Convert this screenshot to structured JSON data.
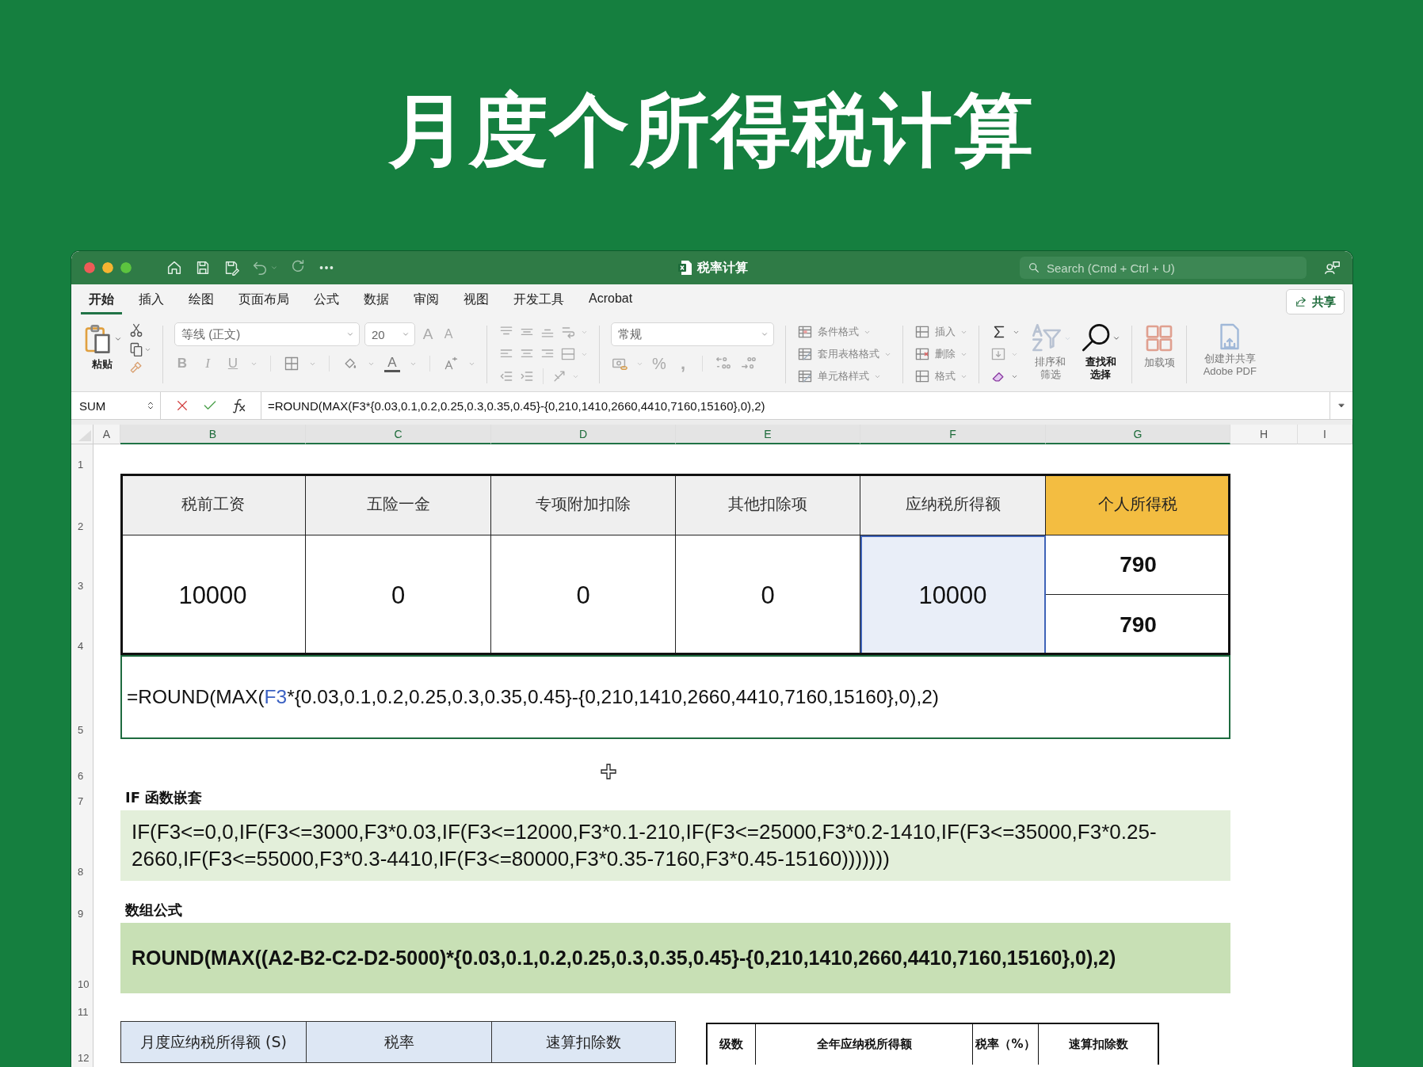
{
  "headline": "月度个所得税计算",
  "window": {
    "title": "税率计算",
    "search_placeholder": "Search (Cmd + Ctrl + U)"
  },
  "ribbon_tabs": [
    {
      "label": "开始",
      "selected": true
    },
    {
      "label": "插入",
      "selected": false
    },
    {
      "label": "绘图",
      "selected": false
    },
    {
      "label": "页面布局",
      "selected": false
    },
    {
      "label": "公式",
      "selected": false
    },
    {
      "label": "数据",
      "selected": false
    },
    {
      "label": "审阅",
      "selected": false
    },
    {
      "label": "视图",
      "selected": false
    },
    {
      "label": "开发工具",
      "selected": false
    },
    {
      "label": "Acrobat",
      "selected": false
    }
  ],
  "share_button": "共享",
  "ribbon": {
    "paste": "粘贴",
    "font_name": "等线 (正文)",
    "font_size": "20",
    "grow_font": "A",
    "shrink_font": "A",
    "bold": "B",
    "italic": "I",
    "underline": "U",
    "font_color": "A",
    "number_format": "常规",
    "percent": "%",
    "comma": ",",
    "styles": [
      "条件格式",
      "套用表格格式",
      "单元格样式"
    ],
    "cells": [
      "插入",
      "删除",
      "格式"
    ],
    "sort_filter": "排序和筛选",
    "find_select": "查找和选择",
    "add_ins": "加载项",
    "adobe": "创建并共享 Adobe PDF"
  },
  "formula_bar": {
    "name_box": "SUM",
    "formula": "=ROUND(MAX(F3*{0.03,0.1,0.2,0.25,0.3,0.35,0.45}-{0,210,1410,2660,4410,7160,15160},0),2)"
  },
  "columns": [
    {
      "label": "A",
      "selected": false
    },
    {
      "label": "B",
      "selected": true
    },
    {
      "label": "C",
      "selected": true
    },
    {
      "label": "D",
      "selected": true
    },
    {
      "label": "E",
      "selected": true
    },
    {
      "label": "F",
      "selected": true
    },
    {
      "label": "G",
      "selected": true
    },
    {
      "label": "H",
      "selected": false
    },
    {
      "label": "I",
      "selected": false
    }
  ],
  "rows": [
    "1",
    "2",
    "3",
    "4",
    "5",
    "6",
    "7",
    "8",
    "9",
    "10",
    "11",
    "12"
  ],
  "tax_table": {
    "headers": [
      {
        "label": "税前工资",
        "highlight": false
      },
      {
        "label": "五险一金",
        "highlight": false
      },
      {
        "label": "专项附加扣除",
        "highlight": false
      },
      {
        "label": "其他扣除项",
        "highlight": false
      },
      {
        "label": "应纳税所得额",
        "highlight": false
      },
      {
        "label": "个人所得税",
        "highlight": true
      }
    ],
    "values": [
      {
        "value": "10000",
        "referenced": false
      },
      {
        "value": "0",
        "referenced": false
      },
      {
        "value": "0",
        "referenced": false
      },
      {
        "value": "0",
        "referenced": false
      },
      {
        "value": "10000",
        "referenced": true
      }
    ],
    "results": [
      "790",
      "790"
    ],
    "formula_cell": {
      "before": "=ROUND(MAX(",
      "reference": "F3",
      "after": "*{0.03,0.1,0.2,0.25,0.3,0.35,0.45}-{0,210,1410,2660,4410,7160,15160},0),2)",
      "selected": true
    }
  },
  "sections": [
    {
      "title": "IF 函数嵌套",
      "formula": "IF(F3<=0,0,IF(F3<=3000,F3*0.03,IF(F3<=12000,F3*0.1-210,IF(F3<=25000,F3*0.2-1410,IF(F3<=35000,F3*0.25-2660,IF(F3<=55000,F3*0.3-4410,IF(F3<=80000,F3*0.35-7160,F3*0.45-15160)))))))",
      "kind": "plain"
    },
    {
      "title": "数组公式",
      "formula": "ROUND(MAX((A2-B2-C2-D2-5000)*{0.03,0.1,0.2,0.25,0.3,0.35,0.45}-{0,210,1410,2660,4410,7160,15160},0),2)",
      "kind": "bold"
    }
  ],
  "rate_table_headers": [
    "月度应纳税所得额 (S)",
    "税率",
    "速算扣除数"
  ],
  "level_table_headers": [
    "级数",
    "全年应纳税所得额",
    "税率（%）",
    "速算扣除数"
  ]
}
